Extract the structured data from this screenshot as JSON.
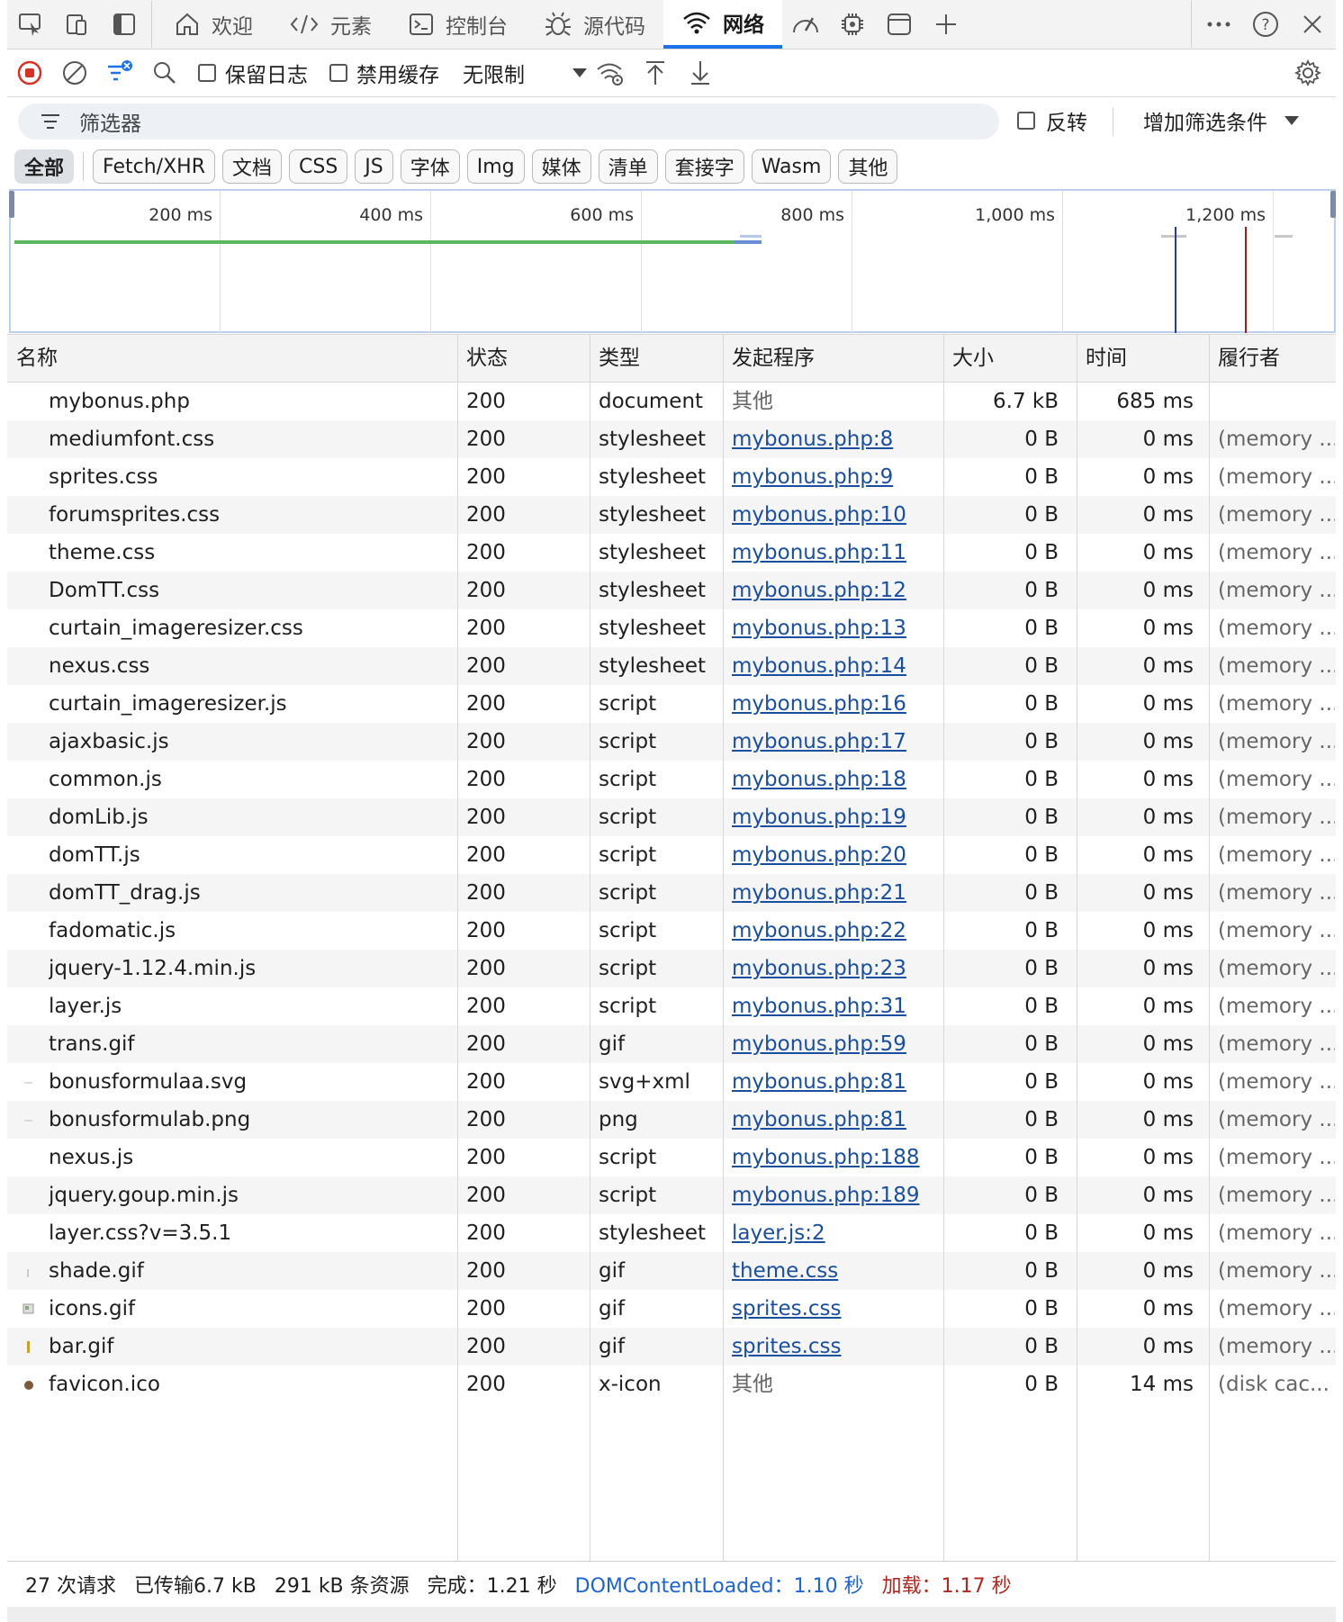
{
  "tabs": [
    {
      "label": "欢迎",
      "icon": "home-icon"
    },
    {
      "label": "元素",
      "icon": "code-icon"
    },
    {
      "label": "控制台",
      "icon": "console-icon"
    },
    {
      "label": "源代码",
      "icon": "bug-icon"
    },
    {
      "label": "网络",
      "icon": "wifi-icon",
      "active": true
    }
  ],
  "toolbar": {
    "preserve_log": "保留日志",
    "disable_cache": "禁用缓存",
    "throttle": "无限制"
  },
  "filter": {
    "placeholder": "筛选器",
    "invert": "反转",
    "add_filter": "增加筛选条件"
  },
  "chips": [
    "全部",
    "Fetch/XHR",
    "文档",
    "CSS",
    "JS",
    "字体",
    "Img",
    "媒体",
    "清单",
    "套接字",
    "Wasm",
    "其他"
  ],
  "overview": {
    "ticks": [
      "200 ms",
      "400 ms",
      "600 ms",
      "800 ms",
      "1,000 ms",
      "1,200 ms"
    ]
  },
  "columns": {
    "name": "名称",
    "status": "状态",
    "type": "类型",
    "initiator": "发起程序",
    "size": "大小",
    "time": "时间",
    "fulfilled": "履行者"
  },
  "rows": [
    {
      "name": "mybonus.php",
      "status": "200",
      "type": "document",
      "initiator": "其他",
      "link": false,
      "size": "6.7 kB",
      "time": "685 ms",
      "fulfilled": ""
    },
    {
      "name": "mediumfont.css",
      "status": "200",
      "type": "stylesheet",
      "initiator": "mybonus.php:8",
      "link": true,
      "size": "0 B",
      "time": "0 ms",
      "fulfilled": "(memory ..."
    },
    {
      "name": "sprites.css",
      "status": "200",
      "type": "stylesheet",
      "initiator": "mybonus.php:9",
      "link": true,
      "size": "0 B",
      "time": "0 ms",
      "fulfilled": "(memory ..."
    },
    {
      "name": "forumsprites.css",
      "status": "200",
      "type": "stylesheet",
      "initiator": "mybonus.php:10",
      "link": true,
      "size": "0 B",
      "time": "0 ms",
      "fulfilled": "(memory ..."
    },
    {
      "name": "theme.css",
      "status": "200",
      "type": "stylesheet",
      "initiator": "mybonus.php:11",
      "link": true,
      "size": "0 B",
      "time": "0 ms",
      "fulfilled": "(memory ..."
    },
    {
      "name": "DomTT.css",
      "status": "200",
      "type": "stylesheet",
      "initiator": "mybonus.php:12",
      "link": true,
      "size": "0 B",
      "time": "0 ms",
      "fulfilled": "(memory ..."
    },
    {
      "name": "curtain_imageresizer.css",
      "status": "200",
      "type": "stylesheet",
      "initiator": "mybonus.php:13",
      "link": true,
      "size": "0 B",
      "time": "0 ms",
      "fulfilled": "(memory ..."
    },
    {
      "name": "nexus.css",
      "status": "200",
      "type": "stylesheet",
      "initiator": "mybonus.php:14",
      "link": true,
      "size": "0 B",
      "time": "0 ms",
      "fulfilled": "(memory ..."
    },
    {
      "name": "curtain_imageresizer.js",
      "status": "200",
      "type": "script",
      "initiator": "mybonus.php:16",
      "link": true,
      "size": "0 B",
      "time": "0 ms",
      "fulfilled": "(memory ..."
    },
    {
      "name": "ajaxbasic.js",
      "status": "200",
      "type": "script",
      "initiator": "mybonus.php:17",
      "link": true,
      "size": "0 B",
      "time": "0 ms",
      "fulfilled": "(memory ..."
    },
    {
      "name": "common.js",
      "status": "200",
      "type": "script",
      "initiator": "mybonus.php:18",
      "link": true,
      "size": "0 B",
      "time": "0 ms",
      "fulfilled": "(memory ..."
    },
    {
      "name": "domLib.js",
      "status": "200",
      "type": "script",
      "initiator": "mybonus.php:19",
      "link": true,
      "size": "0 B",
      "time": "0 ms",
      "fulfilled": "(memory ..."
    },
    {
      "name": "domTT.js",
      "status": "200",
      "type": "script",
      "initiator": "mybonus.php:20",
      "link": true,
      "size": "0 B",
      "time": "0 ms",
      "fulfilled": "(memory ..."
    },
    {
      "name": "domTT_drag.js",
      "status": "200",
      "type": "script",
      "initiator": "mybonus.php:21",
      "link": true,
      "size": "0 B",
      "time": "0 ms",
      "fulfilled": "(memory ..."
    },
    {
      "name": "fadomatic.js",
      "status": "200",
      "type": "script",
      "initiator": "mybonus.php:22",
      "link": true,
      "size": "0 B",
      "time": "0 ms",
      "fulfilled": "(memory ..."
    },
    {
      "name": "jquery-1.12.4.min.js",
      "status": "200",
      "type": "script",
      "initiator": "mybonus.php:23",
      "link": true,
      "size": "0 B",
      "time": "0 ms",
      "fulfilled": "(memory ..."
    },
    {
      "name": "layer.js",
      "status": "200",
      "type": "script",
      "initiator": "mybonus.php:31",
      "link": true,
      "size": "0 B",
      "time": "0 ms",
      "fulfilled": "(memory ..."
    },
    {
      "name": "trans.gif",
      "status": "200",
      "type": "gif",
      "initiator": "mybonus.php:59",
      "link": true,
      "size": "0 B",
      "time": "0 ms",
      "fulfilled": "(memory ..."
    },
    {
      "name": "bonusformulaa.svg",
      "status": "200",
      "type": "svg+xml",
      "initiator": "mybonus.php:81",
      "link": true,
      "size": "0 B",
      "time": "0 ms",
      "fulfilled": "(memory ..."
    },
    {
      "name": "bonusformulab.png",
      "status": "200",
      "type": "png",
      "initiator": "mybonus.php:81",
      "link": true,
      "size": "0 B",
      "time": "0 ms",
      "fulfilled": "(memory ..."
    },
    {
      "name": "nexus.js",
      "status": "200",
      "type": "script",
      "initiator": "mybonus.php:188",
      "link": true,
      "size": "0 B",
      "time": "0 ms",
      "fulfilled": "(memory ..."
    },
    {
      "name": "jquery.goup.min.js",
      "status": "200",
      "type": "script",
      "initiator": "mybonus.php:189",
      "link": true,
      "size": "0 B",
      "time": "0 ms",
      "fulfilled": "(memory ..."
    },
    {
      "name": "layer.css?v=3.5.1",
      "status": "200",
      "type": "stylesheet",
      "initiator": "layer.js:2",
      "link": true,
      "size": "0 B",
      "time": "0 ms",
      "fulfilled": "(memory ..."
    },
    {
      "name": "shade.gif",
      "status": "200",
      "type": "gif",
      "initiator": "theme.css",
      "link": true,
      "size": "0 B",
      "time": "0 ms",
      "fulfilled": "(memory ..."
    },
    {
      "name": "icons.gif",
      "status": "200",
      "type": "gif",
      "initiator": "sprites.css",
      "link": true,
      "size": "0 B",
      "time": "0 ms",
      "fulfilled": "(memory ..."
    },
    {
      "name": "bar.gif",
      "status": "200",
      "type": "gif",
      "initiator": "sprites.css",
      "link": true,
      "size": "0 B",
      "time": "0 ms",
      "fulfilled": "(memory ..."
    },
    {
      "name": "favicon.ico",
      "status": "200",
      "type": "x-icon",
      "initiator": "其他",
      "link": false,
      "size": "0 B",
      "time": "14 ms",
      "fulfilled": "(disk cac..."
    }
  ],
  "footer": {
    "requests": "27 次请求",
    "transferred": "已传输6.7 kB",
    "resources": "291 kB 条资源",
    "finish": "完成：1.21 秒",
    "dcl": "DOMContentLoaded：1.10 秒",
    "load": "加载：1.17 秒"
  },
  "colors": {
    "accent": "#1a73e8",
    "record": "#d93025",
    "link": "#1a4fa0",
    "dcl": "#1a63d8",
    "load": "#b3261e",
    "waterfall_green": "#5cb85c"
  }
}
